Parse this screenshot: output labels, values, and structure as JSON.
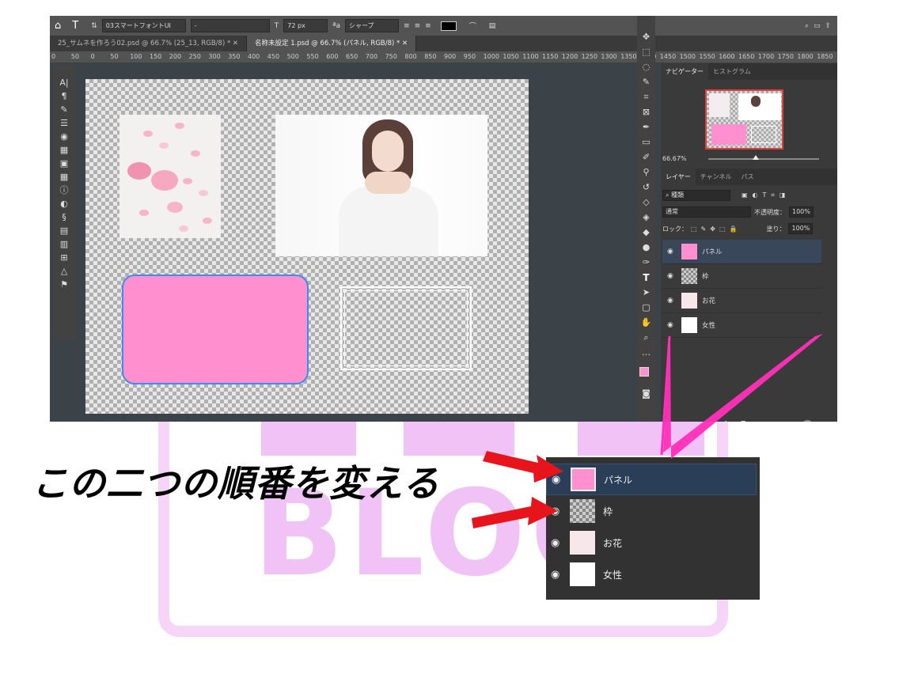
{
  "watermark": {
    "text": "BLOG"
  },
  "options_bar": {
    "font_family": "03スマートフォントUI",
    "font_style": "-",
    "font_size": "72 px",
    "aa_label": "ªa",
    "antialias": "シャープ"
  },
  "tabs": [
    {
      "label": "25_サムネを作ろう02.psd @ 66.7% (25_13, RGB/8) *",
      "active": false
    },
    {
      "label": "名称未設定 1.psd @ 66.7% (パネル, RGB/8) *",
      "active": true
    }
  ],
  "ruler_ticks": [
    "0",
    "50",
    "0",
    "50",
    "100",
    "150",
    "200",
    "250",
    "300",
    "350",
    "400",
    "450",
    "500",
    "550",
    "600",
    "650",
    "700",
    "750",
    "800",
    "850",
    "900",
    "950",
    "1000",
    "1050",
    "1100",
    "1150",
    "1200",
    "1250",
    "1300",
    "1350",
    "1400",
    "1450",
    "1500",
    "1550",
    "1600",
    "1650",
    "1700",
    "1750",
    "1800",
    "1850"
  ],
  "navigator": {
    "tabs": [
      "ナビゲーター",
      "ヒストグラム"
    ],
    "zoom": "66.67%"
  },
  "layers_panel": {
    "tabs": [
      "レイヤー",
      "チャンネル",
      "パス"
    ],
    "filter": "種類",
    "blend_mode": "通常",
    "opacity_label": "不透明度：",
    "opacity": "100%",
    "lock_label": "ロック：",
    "fill_label": "塗り：",
    "fill": "100%",
    "layers": [
      {
        "name": "パネル",
        "selected": true
      },
      {
        "name": "枠",
        "selected": false
      },
      {
        "name": "お花",
        "selected": false
      },
      {
        "name": "女性",
        "selected": false
      }
    ]
  },
  "caption": "この二つの順番を変える",
  "colors": {
    "accent_pink": "#ff8fce",
    "arrow_red": "#e8141b",
    "highlight_magenta": "#ff2fb8",
    "selected_layer": "#2b3e58"
  }
}
